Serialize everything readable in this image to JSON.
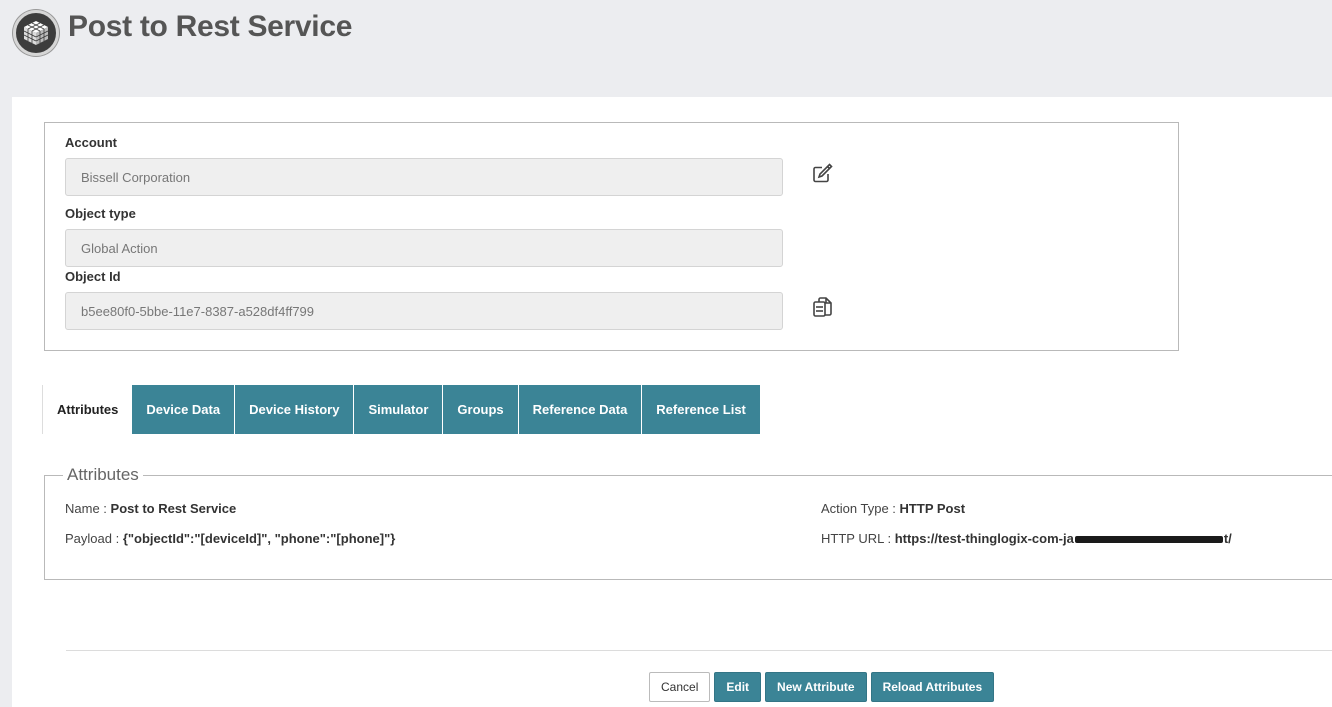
{
  "header": {
    "title": "Post to Rest Service",
    "logo_icon": "cube-logo-icon"
  },
  "fields": {
    "account": {
      "label": "Account",
      "value": "Bissell Corporation"
    },
    "object_type": {
      "label": "Object type",
      "value": "Global Action"
    },
    "object_id": {
      "label": "Object Id",
      "value": "b5ee80f0-5bbe-11e7-8387-a528df4ff799"
    }
  },
  "icons": {
    "edit": "edit-icon",
    "copy": "copy-icon"
  },
  "tabs": [
    {
      "label": "Attributes",
      "active": true
    },
    {
      "label": "Device Data",
      "active": false
    },
    {
      "label": "Device History",
      "active": false
    },
    {
      "label": "Simulator",
      "active": false
    },
    {
      "label": "Groups",
      "active": false
    },
    {
      "label": "Reference Data",
      "active": false
    },
    {
      "label": "Reference List",
      "active": false
    }
  ],
  "attributes": {
    "legend": "Attributes",
    "name": {
      "label": "Name :",
      "value": "Post to Rest Service"
    },
    "payload": {
      "label": "Payload :",
      "value": "{\"objectId\":\"[deviceId]\", \"phone\":\"[phone]\"}"
    },
    "action_type": {
      "label": "Action Type :",
      "value": "HTTP Post"
    },
    "http_url": {
      "label": "HTTP URL :",
      "value_start": "https://test-thinglogix-com-ja",
      "value_end": "t/"
    }
  },
  "actions": {
    "cancel": "Cancel",
    "edit": "Edit",
    "new_attribute": "New Attribute",
    "reload_attributes": "Reload Attributes"
  },
  "colors": {
    "accent": "#3b8496",
    "background": "#ecedf0"
  }
}
